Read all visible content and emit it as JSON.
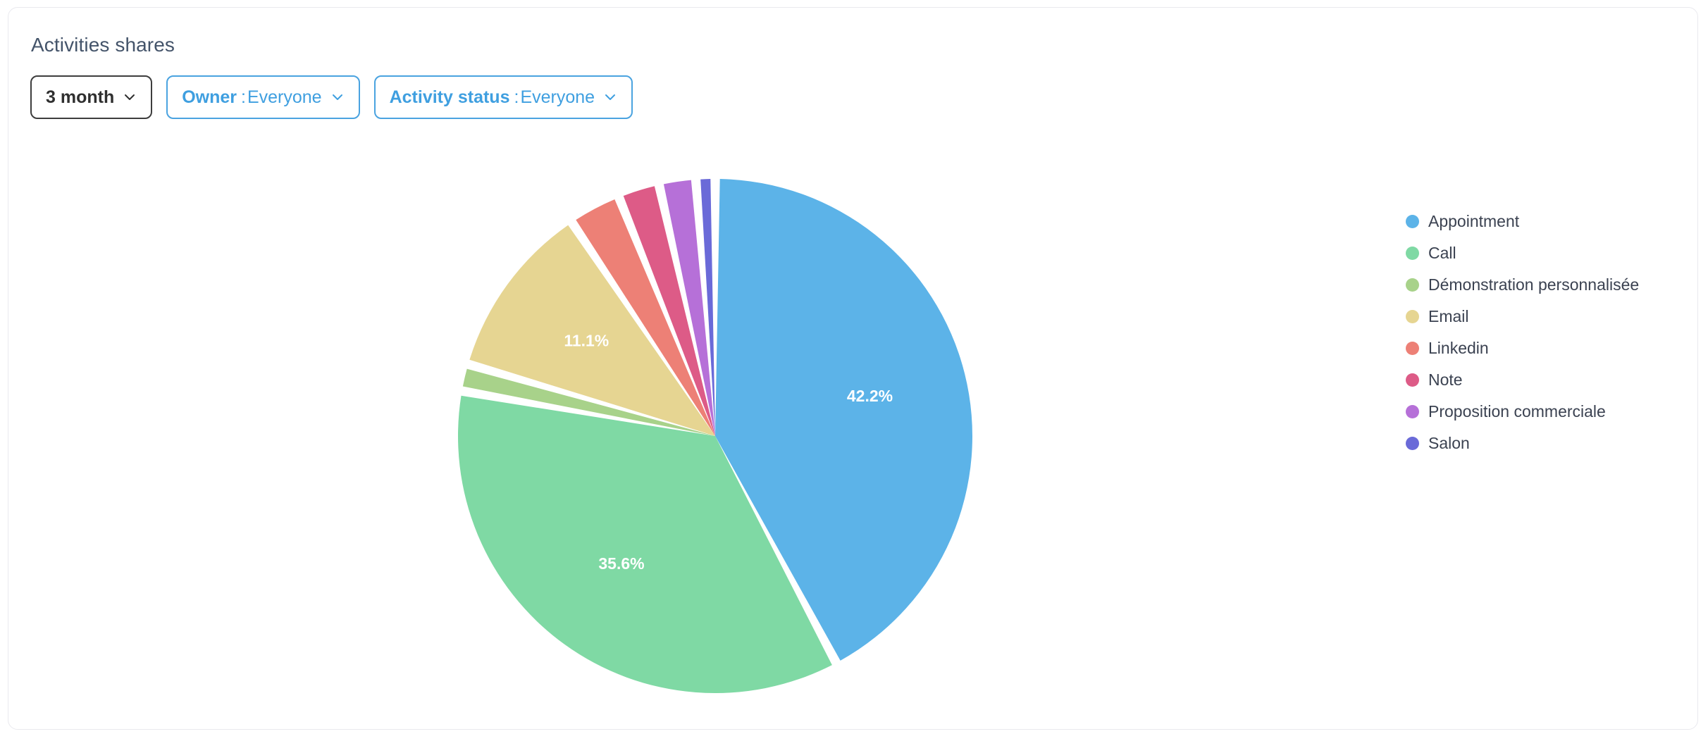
{
  "card": {
    "title": "Activities shares"
  },
  "filters": [
    {
      "name": "period",
      "key": "3 month",
      "separator": "",
      "value": "",
      "style": "dark",
      "icon": "chevron-down-icon"
    },
    {
      "name": "owner",
      "key": "Owner",
      "separator": ":",
      "value": "Everyone",
      "style": "blue",
      "icon": "chevron-down-icon"
    },
    {
      "name": "activity-status",
      "key": "Activity status",
      "separator": ":",
      "value": "Everyone",
      "style": "blue",
      "icon": "chevron-down-icon"
    }
  ],
  "legend": {
    "position": "right",
    "items": [
      {
        "label": "Appointment",
        "color": "#5cb3e8"
      },
      {
        "label": "Call",
        "color": "#7fd9a4"
      },
      {
        "label": "Démonstration personnalisée",
        "color": "#a8d28a"
      },
      {
        "label": "Email",
        "color": "#e6d592"
      },
      {
        "label": "Linkedin",
        "color": "#ed8076"
      },
      {
        "label": "Note",
        "color": "#dd5b87"
      },
      {
        "label": "Proposition commerciale",
        "color": "#b670d8"
      },
      {
        "label": "Salon",
        "color": "#6a6ad8"
      }
    ]
  },
  "chart_data": {
    "type": "pie",
    "title": "Activities shares",
    "labels": [
      "Appointment",
      "Call",
      "Démonstration personnalisée",
      "Email",
      "Linkedin",
      "Note",
      "Proposition commerciale",
      "Salon"
    ],
    "values": [
      42.2,
      35.6,
      1.7,
      11.1,
      3.3,
      2.6,
      2.3,
      1.2
    ],
    "unit": "%",
    "colors": [
      "#5cb3e8",
      "#7fd9a4",
      "#a8d28a",
      "#e6d592",
      "#ed8076",
      "#dd5b87",
      "#b670d8",
      "#6a6ad8"
    ],
    "visible_labels": [
      {
        "label": "Appointment",
        "text": "42.2%"
      },
      {
        "label": "Call",
        "text": "35.6%"
      },
      {
        "label": "Email",
        "text": "11.1%"
      }
    ],
    "start_angle_deg": 0,
    "direction": "clockwise",
    "legend_position": "right",
    "grid": false
  }
}
